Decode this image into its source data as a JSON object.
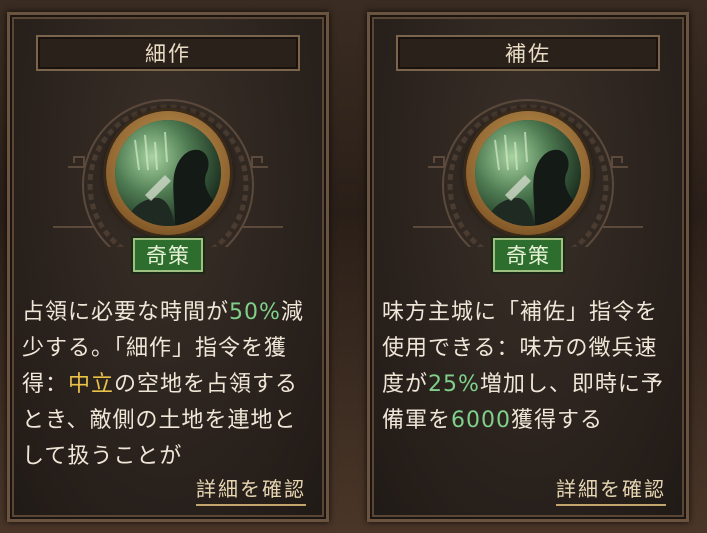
{
  "cards": [
    {
      "title": "細作",
      "badge": "奇策",
      "desc": [
        {
          "t": "占領に必要な時間が"
        },
        {
          "t": "50%",
          "c": "green"
        },
        {
          "t": "減少する。「細作」指令を獲得："
        },
        {
          "t": "中立",
          "c": "gold"
        },
        {
          "t": "の空地を占領するとき、敵側の土地を連地として扱うことが"
        }
      ],
      "detail": "詳細を確認"
    },
    {
      "title": "補佐",
      "badge": "奇策",
      "desc": [
        {
          "t": "味方主城に「補佐」指令を使用できる：味方の徴兵速度が"
        },
        {
          "t": "25%",
          "c": "green"
        },
        {
          "t": "増加し、即時に予備軍を"
        },
        {
          "t": "6000",
          "c": "green"
        },
        {
          "t": "獲得する"
        }
      ],
      "detail": "詳細を確認"
    }
  ],
  "colors": {
    "highlight_green": "#7fd08a",
    "highlight_gold": "#e9c24a",
    "badge_green": "#2d6e2f"
  },
  "icons": {
    "medal": "strategist-silhouette-icon",
    "ornament": "fretwork-ornament-icon"
  }
}
